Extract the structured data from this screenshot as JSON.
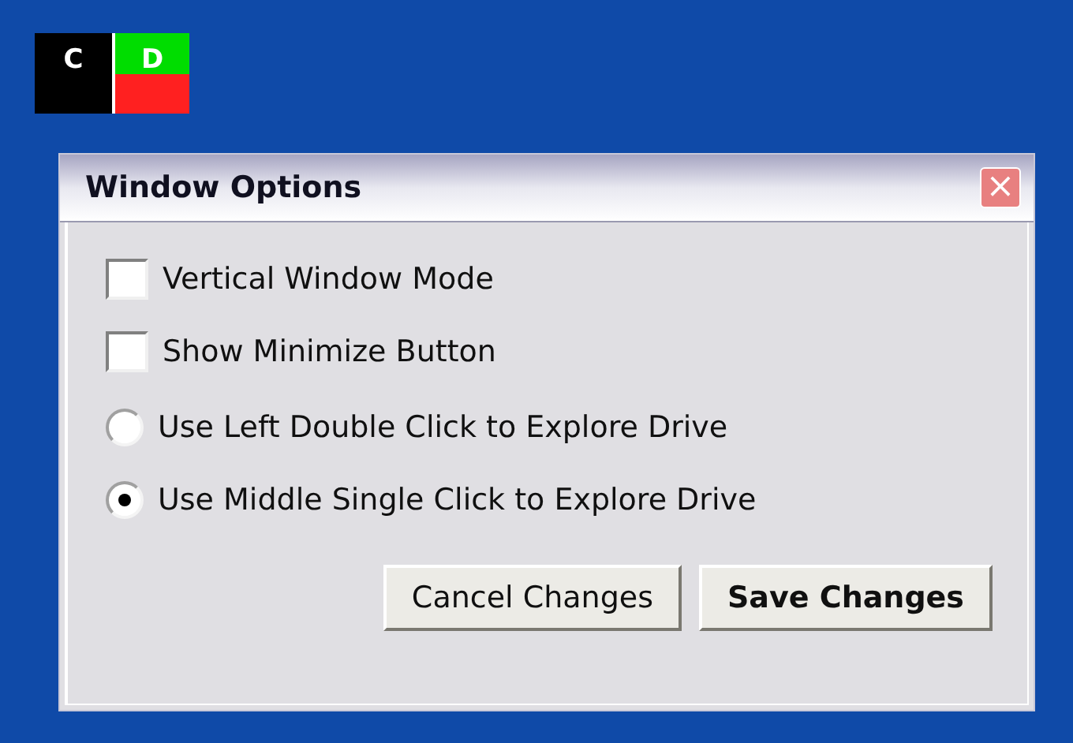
{
  "drives": [
    {
      "letter": "C",
      "segments": [
        {
          "color": "#000000"
        }
      ]
    },
    {
      "letter": "D",
      "segments": [
        {
          "color": "#00dd00"
        },
        {
          "color": "#ff2020"
        }
      ]
    }
  ],
  "window": {
    "title": "Window Options",
    "close_glyph": "×"
  },
  "options": [
    {
      "kind": "checkbox",
      "label": "Vertical Window Mode",
      "checked": false
    },
    {
      "kind": "checkbox",
      "label": "Show Minimize Button",
      "checked": false
    },
    {
      "kind": "radio",
      "label": "Use Left Double Click to Explore Drive",
      "selected": false
    },
    {
      "kind": "radio",
      "label": "Use Middle Single Click to Explore Drive",
      "selected": true
    }
  ],
  "buttons": [
    {
      "label": "Cancel Changes",
      "default": false
    },
    {
      "label": "Save Changes",
      "default": true
    }
  ]
}
